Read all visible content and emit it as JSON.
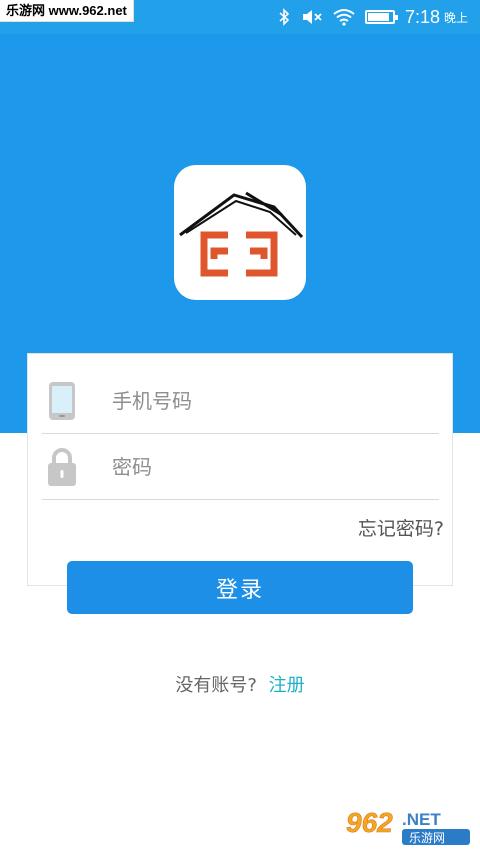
{
  "status_bar": {
    "watermark": "乐游网 www.962.net",
    "time": "7:18",
    "ampm": "晚上",
    "battery_level": 0.9,
    "icons": [
      "bluetooth-icon",
      "mute-icon",
      "wifi-icon",
      "battery-icon"
    ]
  },
  "app": {
    "logo_icon": "house-logo-icon",
    "colors": {
      "primary": "#1d98ea",
      "button": "#1d8fe6",
      "logo_accent": "#e0562c",
      "link": "#1eb0c8"
    }
  },
  "form": {
    "phone_placeholder": "手机号码",
    "password_placeholder": "密码",
    "forgot_label": "忘记密码?"
  },
  "login_label": "登录",
  "register": {
    "question": "没有账号?",
    "link_label": "注册"
  },
  "watermark_bottom": {
    "num": "962",
    "suffix": ".NET",
    "sub": "乐游网"
  }
}
